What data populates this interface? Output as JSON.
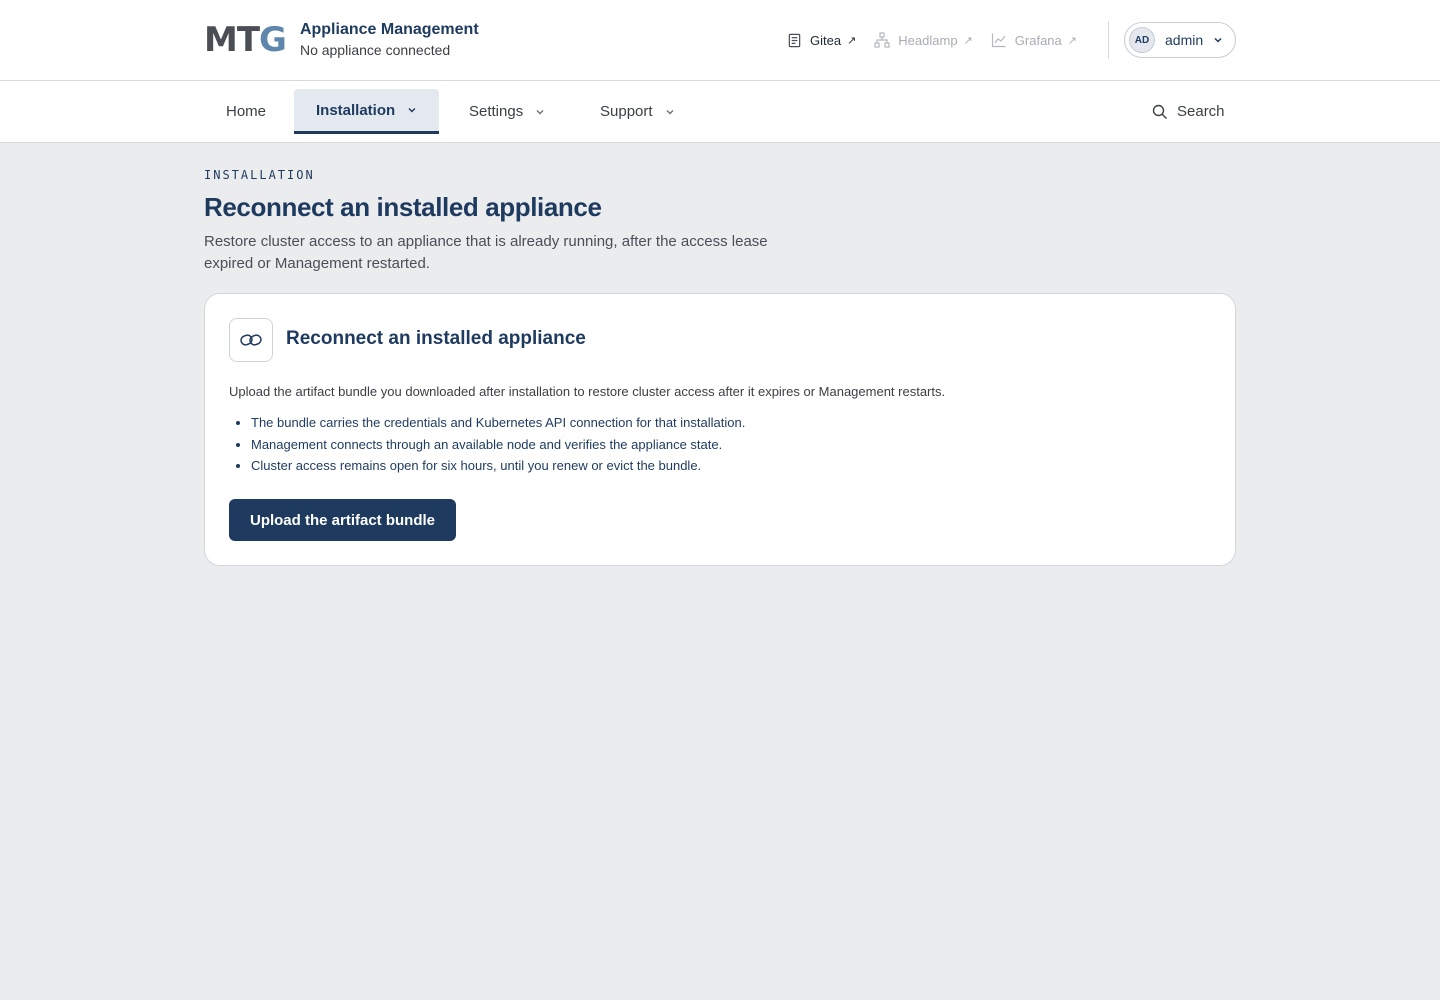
{
  "header": {
    "logo_left": "MT",
    "logo_right": "G",
    "app_title": "Appliance Management",
    "app_subtitle": "No appliance connected",
    "external_links": [
      {
        "label": "Gitea",
        "icon": "document-icon",
        "state": "active"
      },
      {
        "label": "Headlamp",
        "icon": "network-icon",
        "state": "disabled"
      },
      {
        "label": "Grafana",
        "icon": "chart-icon",
        "state": "disabled"
      }
    ],
    "user": {
      "initials": "AD",
      "name": "admin"
    }
  },
  "nav": {
    "tabs": [
      {
        "label": "Home"
      },
      {
        "label": "Installation",
        "active": true
      },
      {
        "label": "Settings"
      },
      {
        "label": "Support"
      }
    ],
    "search_label": "Search"
  },
  "page": {
    "eyebrow": "INSTALLATION",
    "title": "Reconnect an installed appliance",
    "description": "Restore cluster access to an appliance that is already running, after the access lease expired or Management restarted."
  },
  "card": {
    "title": "Reconnect an installed appliance",
    "intro": "Upload the artifact bundle you downloaded after installation to restore cluster access after it expires or Management restarts.",
    "bullets": [
      "The bundle carries the credentials and Kubernetes API connection for that installation.",
      "Management connects through an available node and verifies the appliance state.",
      "Cluster access remains open for six hours, until you renew or evict the bundle."
    ],
    "button_label": "Upload the artifact bundle"
  },
  "colors": {
    "primary": "#1e3a5f",
    "logo_accent": "#5f87ad",
    "background": "#ebecee"
  }
}
